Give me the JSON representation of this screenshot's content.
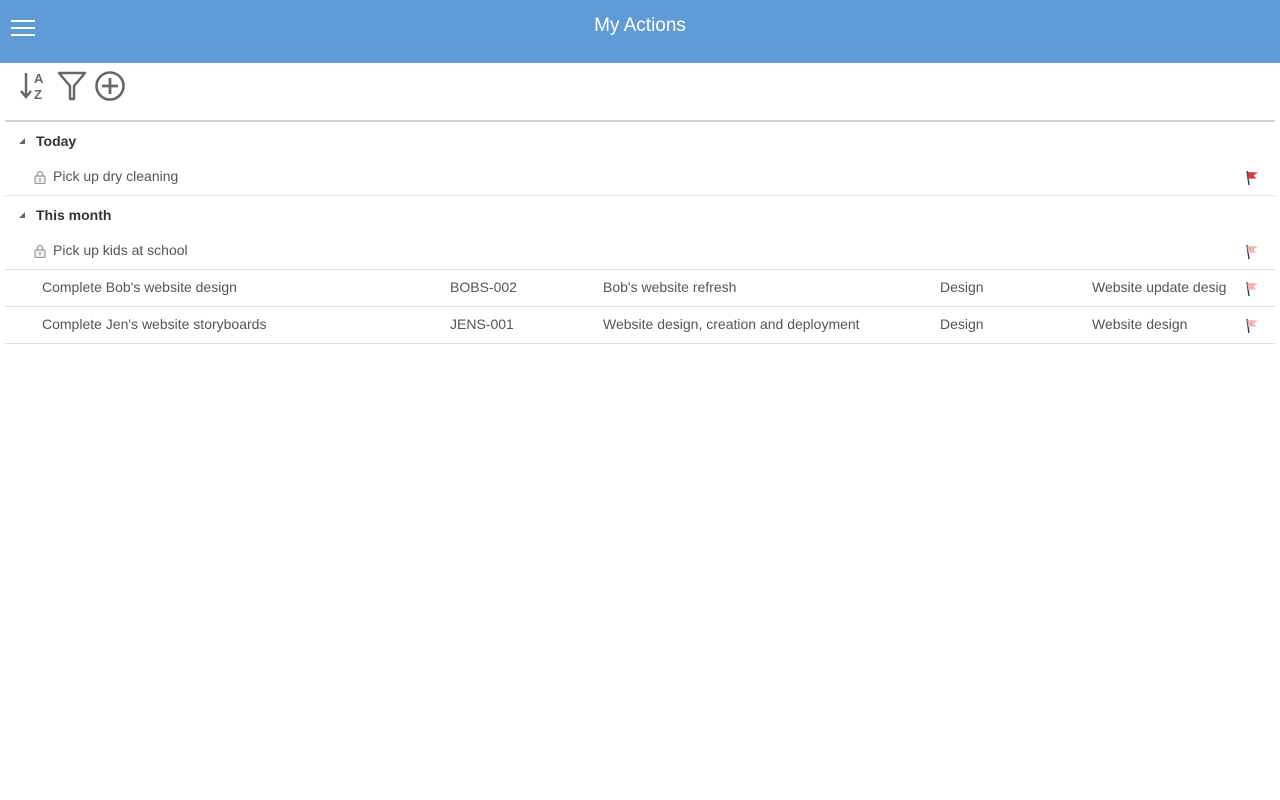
{
  "header": {
    "title": "My Actions",
    "menu_icon": "hamburger-menu-icon",
    "bar_color": "#5f9bd6"
  },
  "toolbar": {
    "sort_icon": "sort-az-icon",
    "filter_icon": "filter-icon",
    "add_icon": "add-circle-icon"
  },
  "groups": [
    {
      "label": "Today",
      "rows": [
        {
          "title": "Pick up dry cleaning",
          "flag": "red"
        }
      ]
    },
    {
      "label": "This month",
      "rows": [
        {
          "title": "Pick up kids at school",
          "flag": "pale"
        },
        {
          "title": "Complete Bob's website design",
          "code": "BOBS-002",
          "project": "Bob's website refresh",
          "category": "Design",
          "task": "Website update desig",
          "flag": "pale"
        },
        {
          "title": "Complete Jen's website storyboards",
          "code": "JENS-001",
          "project": "Website design, creation and deployment",
          "category": "Design",
          "task": "Website design",
          "flag": "pale"
        }
      ]
    }
  ],
  "flag_colors": {
    "red": "#d9383a",
    "pale": "#f2b3b3",
    "pole": "#2b3a7a"
  }
}
